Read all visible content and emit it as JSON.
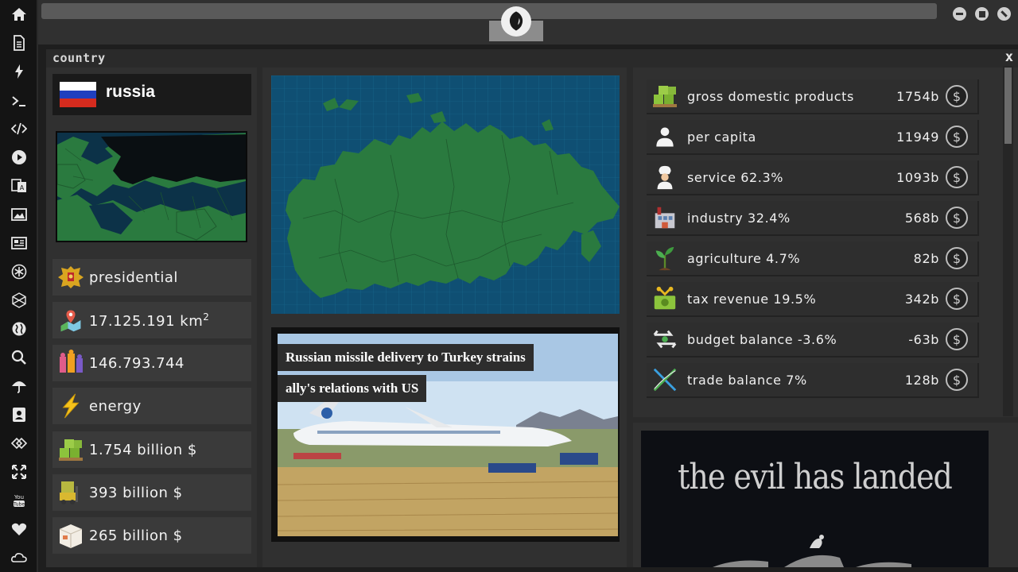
{
  "window": {
    "title": "country",
    "close_label": "x"
  },
  "sidebar": {
    "items": [
      {
        "icon": "home-icon"
      },
      {
        "icon": "document-icon"
      },
      {
        "icon": "lightning-icon"
      },
      {
        "icon": "terminal-icon"
      },
      {
        "icon": "code-icon"
      },
      {
        "icon": "play-icon"
      },
      {
        "icon": "translate-icon"
      },
      {
        "icon": "image-icon"
      },
      {
        "icon": "newspaper-icon"
      },
      {
        "icon": "asterisk-icon"
      },
      {
        "icon": "hexagon-icon"
      },
      {
        "icon": "globe-icon"
      },
      {
        "icon": "search-icon"
      },
      {
        "icon": "umbrella-icon"
      },
      {
        "icon": "contact-icon"
      },
      {
        "icon": "tag-icon"
      },
      {
        "icon": "expand-icon"
      },
      {
        "icon": "youtube-icon"
      },
      {
        "icon": "heart-icon"
      },
      {
        "icon": "cloud-icon"
      }
    ],
    "youtube_text": "You Tube"
  },
  "country": {
    "name": "russia",
    "flag_colors": [
      "#ffffff",
      "#1f3fbf",
      "#d52b1e"
    ],
    "stats": [
      {
        "icon": "coat-of-arms-icon",
        "text": "presidential"
      },
      {
        "icon": "map-pin-icon",
        "text": "17.125.191 km",
        "sup": "2"
      },
      {
        "icon": "people-icon",
        "text": "146.793.744"
      },
      {
        "icon": "energy-bolt-icon",
        "text": "energy"
      },
      {
        "icon": "money-pallet-icon",
        "text": "1.754 billion $"
      },
      {
        "icon": "forklift-icon",
        "text": "393 billion $"
      },
      {
        "icon": "cardboard-box-icon",
        "text": "265 billion $"
      }
    ]
  },
  "news": {
    "headline_line1": "Russian missile delivery to Turkey strains",
    "headline_line2": "ally's relations with US"
  },
  "economy": {
    "currency_symbol": "$",
    "rows": [
      {
        "icon": "money-pallet-icon",
        "label": "gross domestic products",
        "value": "1754b"
      },
      {
        "icon": "person-icon",
        "label": "per capita",
        "value": "11949"
      },
      {
        "icon": "chef-icon",
        "label": "service 62.3%",
        "value": "1093b"
      },
      {
        "icon": "factory-icon",
        "label": "industry 32.4%",
        "value": "568b"
      },
      {
        "icon": "plant-icon",
        "label": "agriculture 4.7%",
        "value": "82b"
      },
      {
        "icon": "tax-money-icon",
        "label": "tax revenue 19.5%",
        "value": "342b"
      },
      {
        "icon": "balance-arrows-icon",
        "label": "budget balance -3.6%",
        "value": "-63b"
      },
      {
        "icon": "trade-cross-icon",
        "label": "trade balance 7%",
        "value": "128b"
      }
    ]
  },
  "ad": {
    "text": "the evil has landed"
  }
}
